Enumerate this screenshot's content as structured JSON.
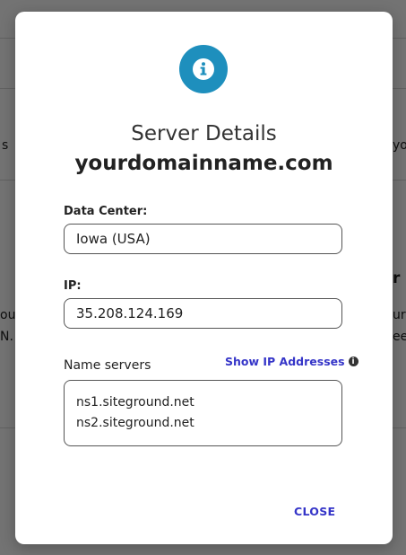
{
  "background": {
    "fragments": [
      "s",
      "yo",
      "r",
      "ou",
      "N.",
      "ur",
      "ee"
    ]
  },
  "modal": {
    "icon": "info-icon",
    "title": "Server Details",
    "domain": "yourdomainname.com",
    "data_center": {
      "label": "Data Center:",
      "value": "Iowa (USA)"
    },
    "ip": {
      "label": "IP:",
      "value": "35.208.124.169"
    },
    "name_servers": {
      "label": "Name servers",
      "show_ip_link": "Show IP Addresses",
      "info_icon": "info-icon",
      "values": [
        "ns1.siteground.net",
        "ns2.siteground.net"
      ]
    },
    "close_label": "CLOSE"
  },
  "colors": {
    "accent": "#1e8fbd",
    "link": "#3535c8",
    "overlay": "rgba(0,0,0,0.55)"
  }
}
